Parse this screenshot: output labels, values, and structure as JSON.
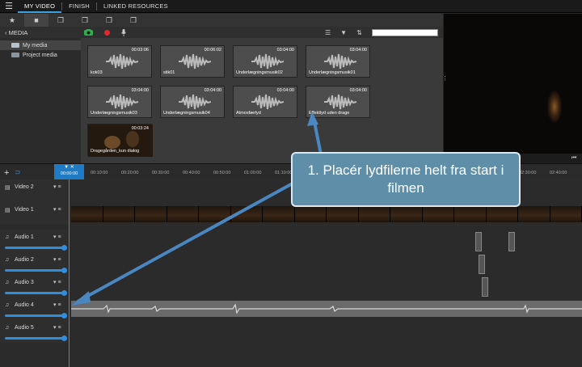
{
  "topnav": {
    "menu_icon": "hamburger-icon",
    "tabs": [
      "MY VIDEO",
      "FINISH",
      "LINKED RESOURCES"
    ]
  },
  "toolbar": {
    "icons": [
      "star-icon",
      "media-folder-icon",
      "stack-icon",
      "layers-icon",
      "image-layers-icon",
      "image-stack-icon"
    ]
  },
  "media": {
    "back_label": "‹ MEDIA",
    "search_placeholder": "",
    "folders": [
      "My media",
      "Project media"
    ],
    "clips": [
      {
        "name": "kok03",
        "duration": "00:03:06",
        "type": "audio"
      },
      {
        "name": "stik01",
        "duration": "00:06:02",
        "type": "audio"
      },
      {
        "name": "Underlægningsmusik02",
        "duration": "03:04:00",
        "type": "audio"
      },
      {
        "name": "Underlægningsmusik01",
        "duration": "03:04:00",
        "type": "audio"
      },
      {
        "name": "Underlægningsmusik03",
        "duration": "03:04:00",
        "type": "audio"
      },
      {
        "name": "Underlægningsmusik04",
        "duration": "03:04:00",
        "type": "audio"
      },
      {
        "name": "Atmosfærlyd",
        "duration": "03:04:00",
        "type": "audio"
      },
      {
        "name": "Effektlyd uden drage",
        "duration": "03:04:00",
        "type": "audio"
      },
      {
        "name": "Dragegården_kun dialog",
        "duration": "00:03:24",
        "type": "video"
      }
    ]
  },
  "timeline": {
    "playhead_time": "00:00:00",
    "ruler_ticks": [
      "00:10:00",
      "00:20:00",
      "00:30:00",
      "00:40:00",
      "00:50:00",
      "01:00:00",
      "01:10:00",
      "02:30:00",
      "02:40:00"
    ],
    "tracks": [
      {
        "label": "Video 2",
        "kind": "video"
      },
      {
        "label": "Video 1",
        "kind": "video"
      },
      {
        "label": "Audio 1",
        "kind": "audio"
      },
      {
        "label": "Audio 2",
        "kind": "audio"
      },
      {
        "label": "Audio 3",
        "kind": "audio"
      },
      {
        "label": "Audio 4",
        "kind": "audio"
      },
      {
        "label": "Audio 5",
        "kind": "audio"
      }
    ]
  },
  "callout": {
    "text": "1. Placér lydfilerne helt fra start i filmen"
  },
  "colors": {
    "accent": "#2c8fe0",
    "callout_bg": "#5f8ea8",
    "record_green": "#2fb04a",
    "record_red": "#e0282e"
  }
}
